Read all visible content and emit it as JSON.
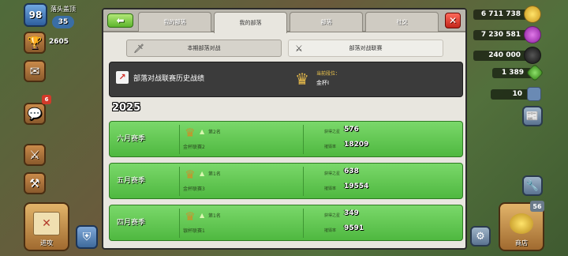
{
  "hud": {
    "xp_level": "98",
    "player_name": "落头盖顶",
    "trophies_badge": "35",
    "trophy_count": "2605",
    "chat_badge": "6",
    "attack_label": "进攻",
    "shop_label": "商店",
    "shop_badge": "56",
    "resources": {
      "gold": "6 711 738",
      "elixir": "7 230 581",
      "dark_elixir": "240 000",
      "gems": "1 389",
      "builders": "10"
    }
  },
  "modal": {
    "back_label": "⬅",
    "close_label": "✕",
    "tabs": [
      {
        "label": "我的部落"
      },
      {
        "label": "我的部落"
      },
      {
        "label": "部落"
      },
      {
        "label": "社交"
      }
    ],
    "subtabs": [
      {
        "label": "本期部落对战",
        "icon": "sword-icon"
      },
      {
        "label": "部落对战联赛",
        "icon": "league-icon"
      }
    ],
    "history": {
      "title": "部落对战联赛历史战绩",
      "current_league_label": "当前段位：",
      "current_league_value": "金杯I"
    },
    "year": "2025",
    "seasons": [
      {
        "name": "六月赛季",
        "rank_text": "第2名",
        "league": "金杯联赛2",
        "stars_label": "获得之星",
        "stars": "576",
        "destruction_label": "摧毁率",
        "destruction": "18209"
      },
      {
        "name": "五月赛季",
        "rank_text": "第1名",
        "league": "金杯联赛3",
        "stars_label": "获得之星",
        "stars": "638",
        "destruction_label": "摧毁率",
        "destruction": "19554"
      },
      {
        "name": "四月赛季",
        "rank_text": "第1名",
        "league": "银杯联赛1",
        "stars_label": "获得之星",
        "stars": "349",
        "destruction_label": "摧毁率",
        "destruction": "9591"
      }
    ]
  }
}
